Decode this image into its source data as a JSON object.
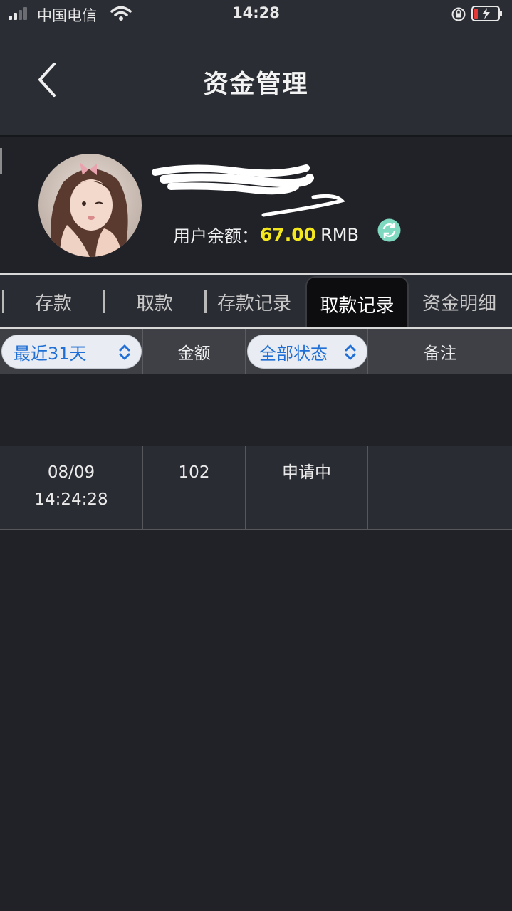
{
  "status_bar": {
    "carrier": "中国电信",
    "time": "14:28"
  },
  "nav": {
    "title": "资金管理"
  },
  "profile": {
    "balance_label": "用户余额：",
    "balance_amount": "67.00",
    "balance_unit": "RMB",
    "amount_color": "#f5e71d"
  },
  "tabs": [
    {
      "label": "存款",
      "active": false
    },
    {
      "label": "取款",
      "active": false
    },
    {
      "label": "存款记录",
      "active": false
    },
    {
      "label": "取款记录",
      "active": true
    },
    {
      "label": "资金明细",
      "active": false
    }
  ],
  "table": {
    "period_select": "最近31天",
    "amount_header": "金额",
    "status_select": "全部状态",
    "note_header": "备注",
    "rows": [
      {
        "date": "08/09",
        "time": "14:24:28",
        "amount": "102",
        "status": "申请中",
        "note": ""
      }
    ]
  },
  "colors": {
    "accent_blue": "#1f6fd6",
    "refresh_green": "#7ed9c0"
  }
}
